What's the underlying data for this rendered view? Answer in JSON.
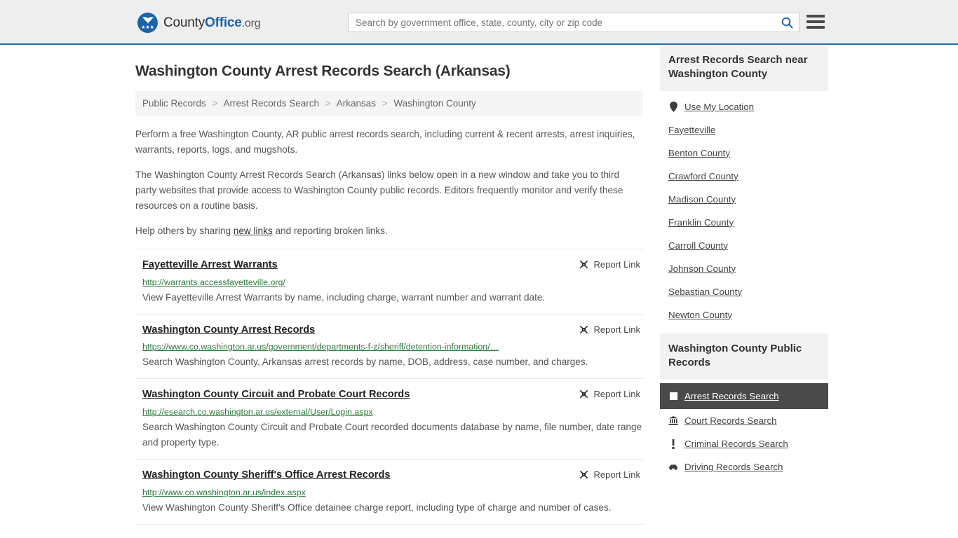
{
  "header": {
    "brand": {
      "text_county": "County",
      "text_office": "Office",
      "text_org": ".org",
      "stars": "★★★"
    },
    "search": {
      "placeholder": "Search by government office, state, county, city or zip code",
      "value": "",
      "icon": "search-icon"
    },
    "menu_icon": "hamburger-menu-icon",
    "accent_color": "#1b63a8",
    "background_color": "#eeeeee"
  },
  "page": {
    "title": "Washington County Arrest Records Search (Arkansas)"
  },
  "breadcrumb": {
    "separator": ">",
    "items": [
      {
        "label": "Public Records"
      },
      {
        "label": "Arrest Records Search"
      },
      {
        "label": "Arkansas"
      },
      {
        "label": "Washington County"
      }
    ]
  },
  "intro": {
    "paragraph1": "Perform a free Washington County, AR public arrest records search, including current & recent arrests, arrest inquiries, warrants, reports, logs, and mugshots.",
    "paragraph2": "The Washington County Arrest Records Search (Arkansas) links below open in a new window and take you to third party websites that provide access to Washington County public records. Editors frequently monitor and verify these resources on a routine basis.",
    "paragraph3_pre": "Help others by sharing ",
    "paragraph3_link": "new links",
    "paragraph3_post": " and reporting broken links."
  },
  "results": {
    "report_label": "Report Link",
    "report_icon": "broken-link-icon",
    "entries": [
      {
        "title": "Fayetteville Arrest Warrants",
        "url": "http://warrants.accessfayetteville.org/",
        "description": "View Fayetteville Arrest Warrants by name, including charge, warrant number and warrant date."
      },
      {
        "title": "Washington County Arrest Records",
        "url": "https://www.co.washington.ar.us/government/departments-f-z/sheriff/detention-information/…",
        "description": "Search Washington County, Arkansas arrest records by name, DOB, address, case number, and charges."
      },
      {
        "title": "Washington County Circuit and Probate Court Records",
        "url": "http://esearch.co.washington.ar.us/external/User/Login.aspx",
        "description": "Search Washington County Circuit and Probate Court recorded documents database by name, file number, date range and property type."
      },
      {
        "title": "Washington County Sheriff's Office Arrest Records",
        "url": "http://www.co.washington.ar.us/index.aspx",
        "description": "View Washington County Sheriff's Office detainee charge report, including type of charge and number of cases."
      }
    ]
  },
  "sidebar": {
    "nearby": {
      "heading": "Arrest Records Search near Washington County",
      "use_my_location": {
        "label": "Use My Location",
        "icon": "map-pin-icon"
      },
      "items": [
        {
          "label": "Fayetteville"
        },
        {
          "label": "Benton County"
        },
        {
          "label": "Crawford County"
        },
        {
          "label": "Madison County"
        },
        {
          "label": "Franklin County"
        },
        {
          "label": "Carroll County"
        },
        {
          "label": "Johnson County"
        },
        {
          "label": "Sebastian County"
        },
        {
          "label": "Newton County"
        }
      ]
    },
    "public_records": {
      "heading": "Washington County Public Records",
      "items": [
        {
          "label": "Arrest Records Search",
          "icon": "white-square-icon",
          "active": true
        },
        {
          "label": "Court Records Search",
          "icon": "courthouse-icon",
          "active": false
        },
        {
          "label": "Criminal Records Search",
          "icon": "exclamation-icon",
          "active": false
        },
        {
          "label": "Driving Records Search",
          "icon": "car-icon",
          "active": false
        }
      ]
    }
  }
}
